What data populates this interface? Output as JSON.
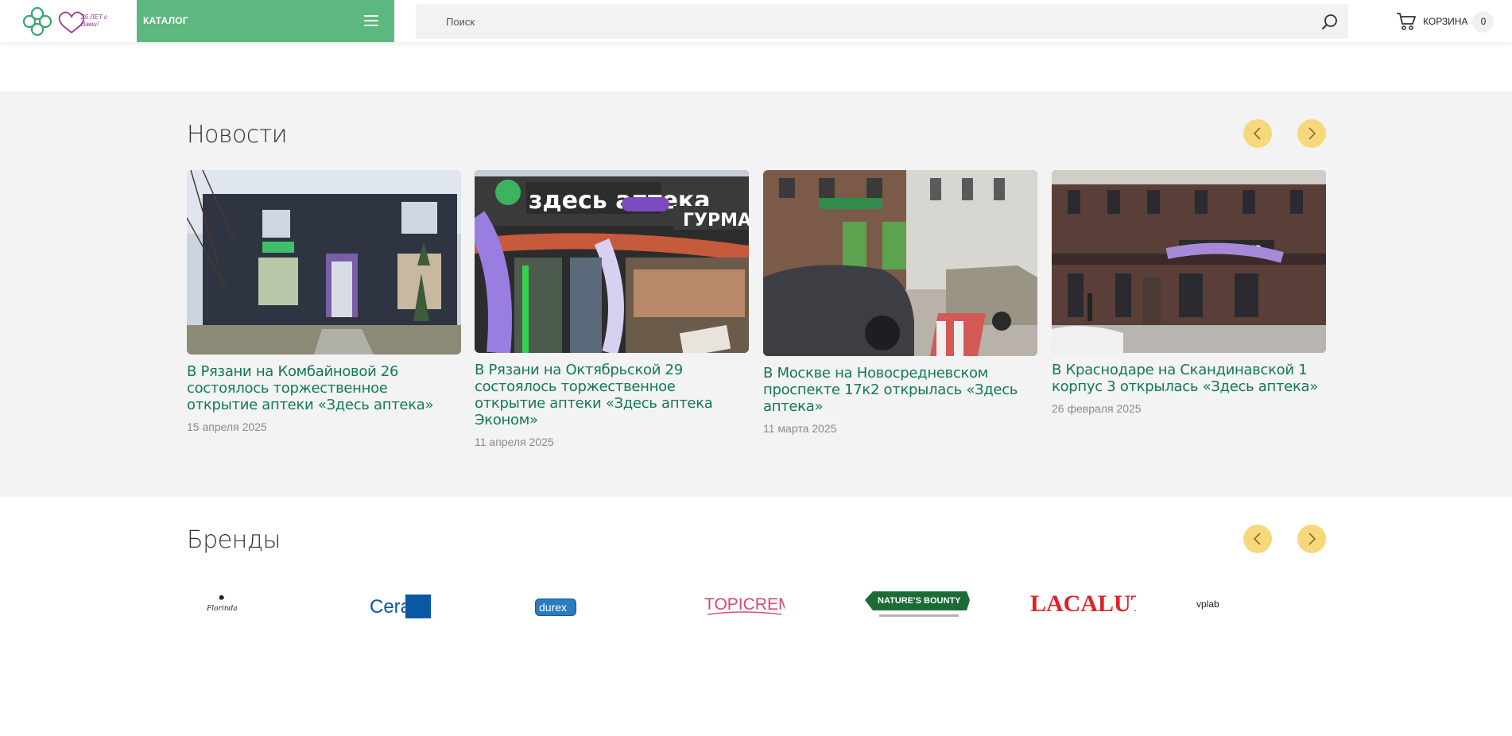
{
  "header": {
    "logo_text": "25 ЛЕТ с Вами!",
    "catalog_label": "КАТАЛОГ",
    "search_placeholder": "Поиск",
    "cart_label": "КОРЗИНА",
    "cart_count": "0"
  },
  "news": {
    "title": "Новости",
    "items": [
      {
        "title": "В Рязани на Комбайновой 26 состоялось торжественное открытие аптеки «Здесь аптека»",
        "date": "15 апреля 2025"
      },
      {
        "title": "В Рязани на Октябрьской 29 состоялось торжественное открытие аптеки «Здесь аптека Эконом»",
        "date": "11 апреля 2025"
      },
      {
        "title": "В Москве на Новосредневском проспекте 17к2 открылась «Здесь аптека»",
        "date": "11 марта 2025"
      },
      {
        "title": "В Краснодаре на Скандинавской 1 корпус 3 открылась «Здесь аптека»",
        "date": "26 февраля 2025"
      }
    ]
  },
  "brands": {
    "title": "Бренды",
    "items": [
      {
        "name": "Florinda"
      },
      {
        "name": "CeraVe"
      },
      {
        "name": "durex"
      },
      {
        "name": "TOPICREM"
      },
      {
        "name": "NATURE'S BOUNTY"
      },
      {
        "name": "LACALUT"
      },
      {
        "name": "vplab"
      }
    ]
  },
  "colors": {
    "brand_green": "#5cb87f",
    "link_green": "#127a52",
    "arrow_yellow": "#f8d87c"
  }
}
